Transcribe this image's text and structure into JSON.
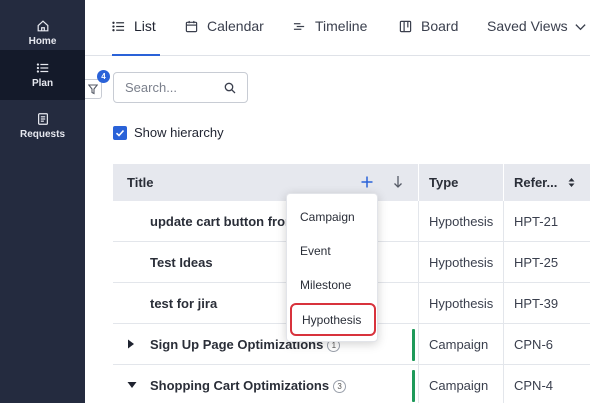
{
  "sidebar": {
    "items": [
      {
        "label": "Home",
        "icon": "home-icon",
        "active": false
      },
      {
        "label": "Plan",
        "icon": "list-icon",
        "active": true
      },
      {
        "label": "Requests",
        "icon": "document-icon",
        "active": false
      }
    ]
  },
  "tabs": [
    {
      "label": "List",
      "icon": "list-icon",
      "active": true
    },
    {
      "label": "Calendar",
      "icon": "calendar-icon",
      "active": false
    },
    {
      "label": "Timeline",
      "icon": "timeline-icon",
      "active": false
    },
    {
      "label": "Board",
      "icon": "board-icon",
      "active": false
    },
    {
      "label": "Saved Views",
      "icon": "chevron-down-icon",
      "active": false
    }
  ],
  "filter": {
    "badge_count": "4"
  },
  "search": {
    "placeholder": "Search...",
    "value": ""
  },
  "show_hierarchy": {
    "label": "Show hierarchy",
    "checked": true
  },
  "table": {
    "columns": {
      "title": "Title",
      "type": "Type",
      "reference": "Refer..."
    },
    "rows": [
      {
        "title": "update cart button from",
        "type": "Hypothesis",
        "ref": "HPT-21",
        "expandable": false,
        "count": ""
      },
      {
        "title": "Test Ideas",
        "type": "Hypothesis",
        "ref": "HPT-25",
        "expandable": false,
        "count": ""
      },
      {
        "title": "test for jira",
        "type": "Hypothesis",
        "ref": "HPT-39",
        "expandable": false,
        "count": ""
      },
      {
        "title": "Sign Up Page Optimizations",
        "type": "Campaign",
        "ref": "CPN-6",
        "expandable": true,
        "expanded": false,
        "count": "1"
      },
      {
        "title": "Shopping Cart Optimizations",
        "type": "Campaign",
        "ref": "CPN-4",
        "expandable": true,
        "expanded": true,
        "count": "3"
      }
    ]
  },
  "add_menu": {
    "items": [
      "Campaign",
      "Event",
      "Milestone",
      "Hypothesis"
    ],
    "highlighted": "Hypothesis"
  },
  "colors": {
    "accent": "#2a62d8",
    "sidebar_bg": "#242b3f",
    "campaign_marker": "#1e9a5a",
    "highlight_outline": "#d8323c"
  }
}
